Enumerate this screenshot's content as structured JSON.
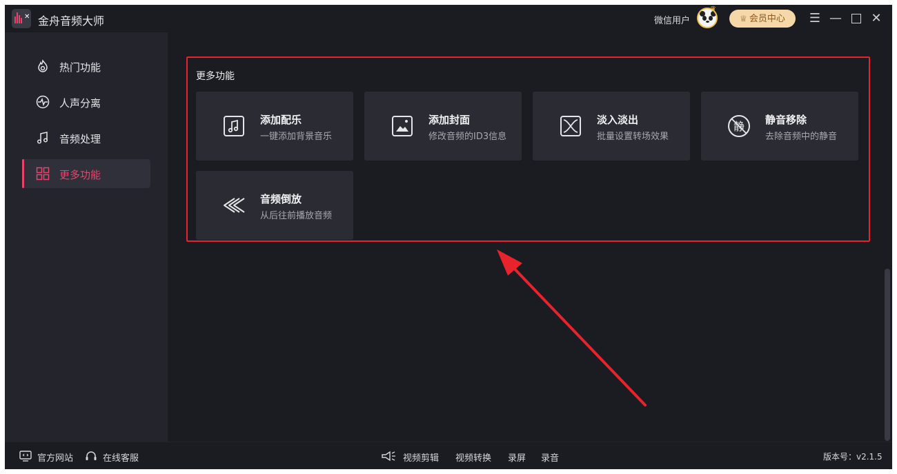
{
  "app": {
    "title": "金舟音频大师",
    "user_name": "微信用户",
    "vip_label": "会员中心"
  },
  "sidebar": {
    "items": [
      {
        "label": "热门功能",
        "icon": "fire-icon",
        "active": false
      },
      {
        "label": "人声分离",
        "icon": "waveform-icon",
        "active": false
      },
      {
        "label": "音频处理",
        "icon": "music-note-icon",
        "active": false
      },
      {
        "label": "更多功能",
        "icon": "grid-icon",
        "active": true
      }
    ]
  },
  "main": {
    "section_title": "更多功能",
    "cards": [
      {
        "title": "添加配乐",
        "subtitle": "一键添加背景音乐",
        "icon": "music-file-icon"
      },
      {
        "title": "添加封面",
        "subtitle": "修改音频的ID3信息",
        "icon": "image-icon"
      },
      {
        "title": "淡入淡出",
        "subtitle": "批量设置转场效果",
        "icon": "crossfade-icon"
      },
      {
        "title": "静音移除",
        "subtitle": "去除音频中的静音",
        "icon": "mute-remove-icon"
      },
      {
        "title": "音频倒放",
        "subtitle": "从后往前播放音频",
        "icon": "rewind-icon"
      }
    ],
    "mute_glyph": "静"
  },
  "footer": {
    "website": "官方网站",
    "support": "在线客服",
    "links": [
      "视频剪辑",
      "视频转换",
      "录屏",
      "录音"
    ],
    "version": "版本号：v2.1.5"
  },
  "colors": {
    "accent": "#e8456c",
    "highlight_red": "#e8232b",
    "vip_bg": "#f6d8a8"
  }
}
